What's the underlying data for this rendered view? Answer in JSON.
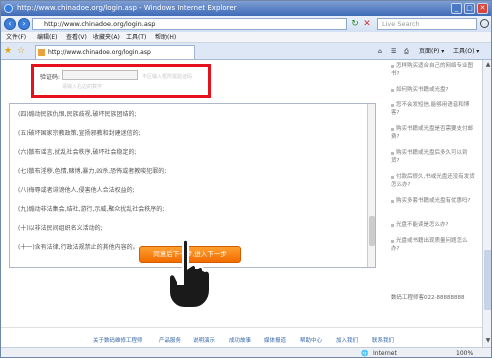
{
  "window": {
    "title": "http://www.chinadoe.org/login.asp - Windows Internet Explorer",
    "minimize": "_",
    "maximize": "□",
    "close": "✕"
  },
  "nav": {
    "address": "http://www.chinadoe.org/login.asp",
    "search_placeholder": "Live Search"
  },
  "menubar": {
    "items": [
      "文件(F)",
      "编辑(E)",
      "查看(V)",
      "收藏夹(A)",
      "工具(T)",
      "帮助(H)"
    ]
  },
  "tabbar": {
    "tab_title": "http://www.chinadoe.org/login.asp",
    "page_label": "页面(P) ▾",
    "tools_label": "工具(O) ▾"
  },
  "form": {
    "captcha_label": "验证码:",
    "captcha_value": "",
    "captcha_hint": "不区输入框所需验证码",
    "captcha_hint2": "请输入右边的数字"
  },
  "terms": {
    "items": [
      "(四)煽动民族仇恨,民族歧视,破坏民族团结的;",
      "(五)破坏国家宗教政策,宣扬邪教和封建迷信的;",
      "(六)散布谣言,扰乱社会秩序,破坏社会稳定的;",
      "(七)散布淫秽,色情,赌博,暴力,凶杀,恐怖或者教唆犯罪的;",
      "(八)侮辱或者诽谤他人,侵害他人合法权益的;",
      "(九)煽动非法集会,结社,游行,示威,聚众扰乱社会秩序的;",
      "(十)以非法民间组织名义活动的;",
      "(十一)含有法律,行政法规禁止的其他内容的。"
    ]
  },
  "sidebar": {
    "items": [
      "怎样购买适合自己的网络专业图书?",
      "如何购买书籍或光盘?",
      "您不会发短信,能够用语音和博客?",
      "购买书籍或光盘是否需要支付邮费?",
      "购买书籍或光盘后多久可以到货?",
      "付款后很久,书或光盘还没有发货怎么办?",
      "购买多套书籍或光盘有优惠吗?",
      "光盘不能读是怎么办?",
      "光盘或书籍出现质量问题怎么办?"
    ],
    "hotline": "数码工程师客022-88888888"
  },
  "action": {
    "agree_button": "同意后下一步,进入下一步"
  },
  "footer": {
    "links": [
      "关于数码维修工程师",
      "产品服务",
      "说明演示",
      "成功故事",
      "媒体报道",
      "帮助中心",
      "加入我们",
      "联系我们"
    ]
  },
  "status": {
    "zone": "Internet",
    "zoom": "100%"
  },
  "colors": {
    "highlight": "#e5111c",
    "button": "#f26b00"
  }
}
